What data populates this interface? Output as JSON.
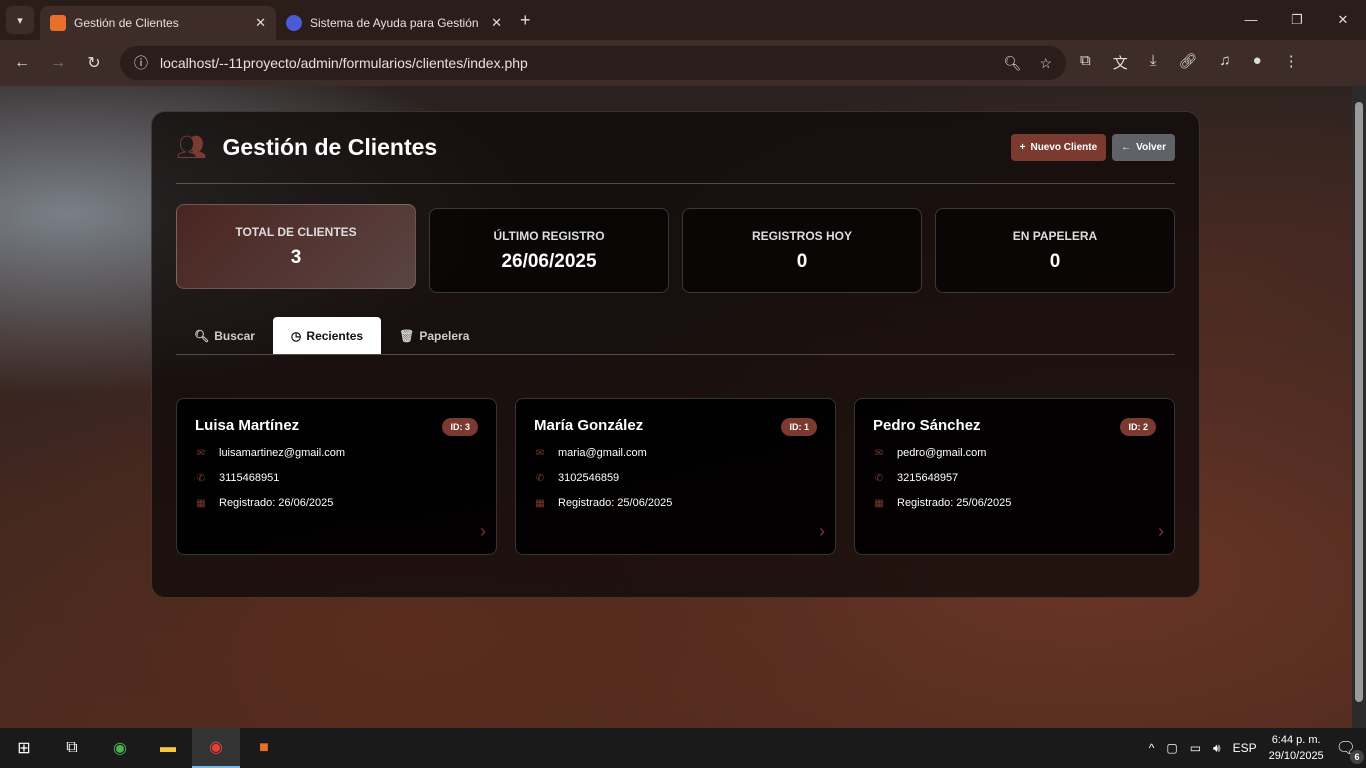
{
  "browser": {
    "tabs": [
      {
        "title": "Gestión de Clientes",
        "active": true
      },
      {
        "title": "Sistema de Ayuda para Gestión",
        "active": false
      }
    ],
    "url": "localhost/--11proyecto/admin/formularios/clientes/index.php"
  },
  "header": {
    "title": "Gestión de Clientes",
    "new_label": "Nuevo Cliente",
    "back_label": "Volver"
  },
  "stats": [
    {
      "label": "TOTAL DE CLIENTES",
      "value": "3"
    },
    {
      "label": "ÚLTIMO REGISTRO",
      "value": "26/06/2025"
    },
    {
      "label": "REGISTROS HOY",
      "value": "0"
    },
    {
      "label": "EN PAPELERA",
      "value": "0"
    }
  ],
  "tabs": [
    {
      "label": "Buscar"
    },
    {
      "label": "Recientes"
    },
    {
      "label": "Papelera"
    }
  ],
  "clients": [
    {
      "name": "Luisa Martínez",
      "id": "ID: 3",
      "email": "luisamartinez@gmail.com",
      "phone": "3115468951",
      "registered": "Registrado: 26/06/2025"
    },
    {
      "name": "María González",
      "id": "ID: 1",
      "email": "maria@gmail.com",
      "phone": "3102546859",
      "registered": "Registrado: 25/06/2025"
    },
    {
      "name": "Pedro Sánchez",
      "id": "ID: 2",
      "email": "pedro@gmail.com",
      "phone": "3215648957",
      "registered": "Registrado: 25/06/2025"
    }
  ],
  "taskbar": {
    "lang": "ESP",
    "time": "6:44 p. m.",
    "date": "29/10/2025",
    "notifications": "6"
  },
  "colors": {
    "accent": "#7a3a30",
    "secondary": "#5f6368"
  }
}
